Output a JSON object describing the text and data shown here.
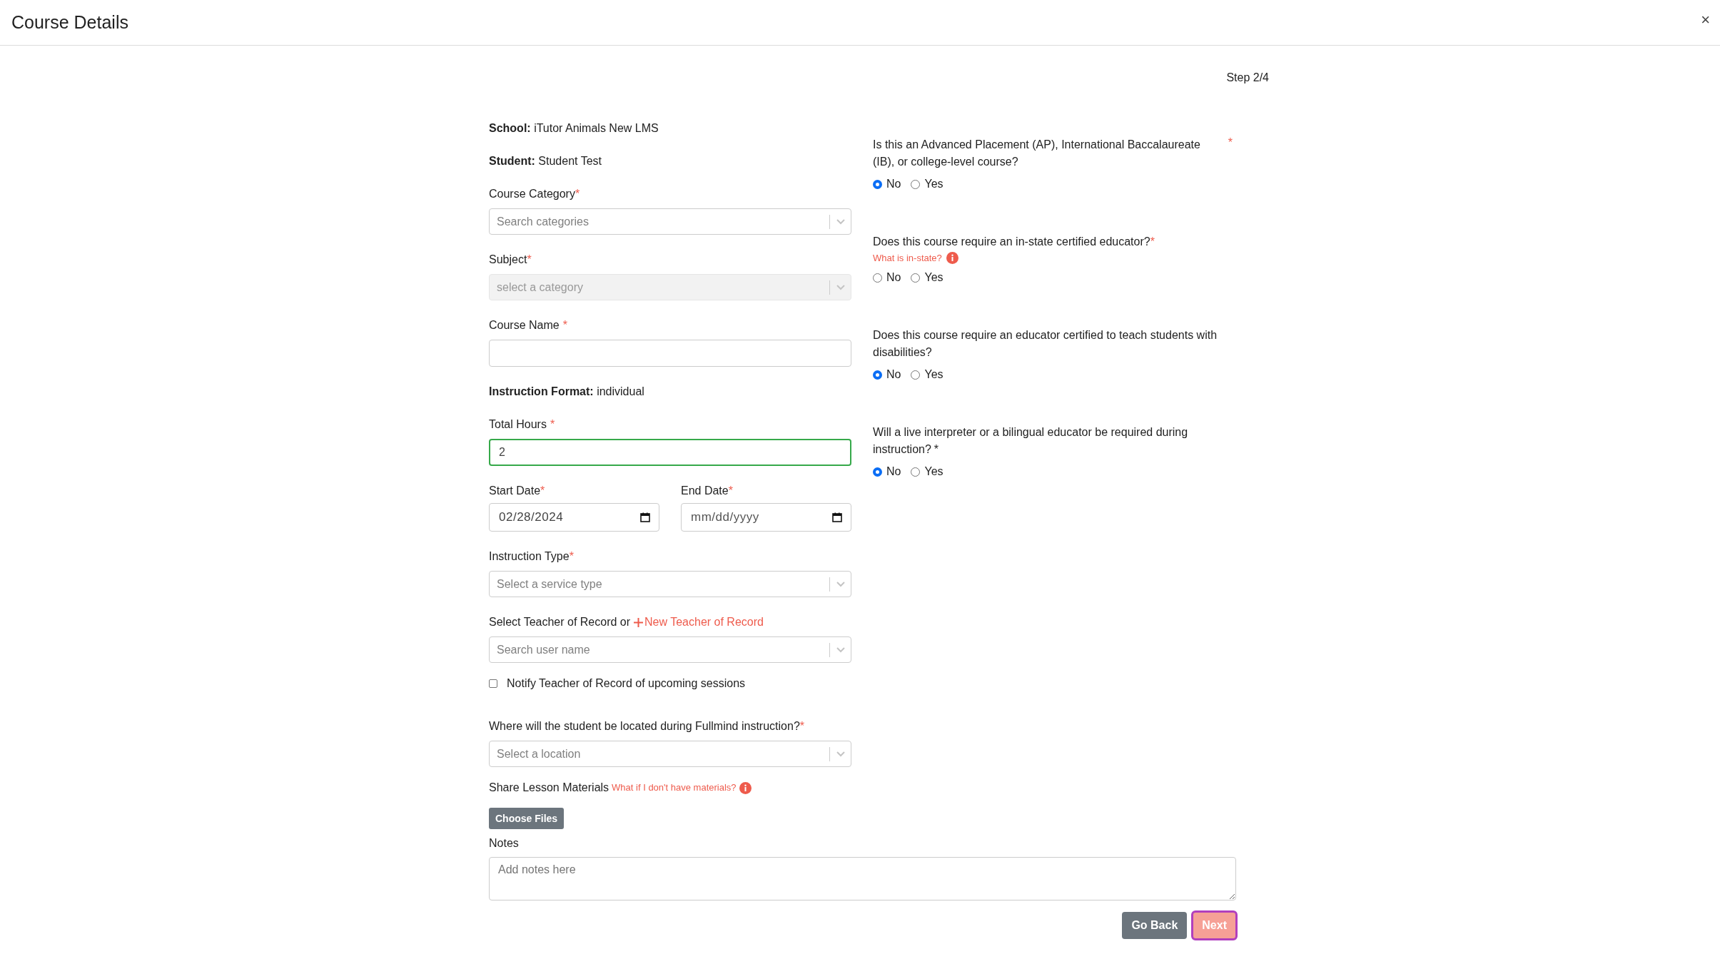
{
  "window": {
    "title": "Course Details",
    "close": "×"
  },
  "step": "Step 2/4",
  "left": [
    {
      "kind": "info",
      "label": "School:",
      "value": "iTutor Animals New LMS"
    },
    {
      "kind": "info",
      "label": "Student:",
      "value": "Student Test"
    },
    {
      "kind": "select",
      "label": "Course Category",
      "asterisk": "*",
      "spaced": false,
      "placeholder": "Search categories",
      "disabled": false
    },
    {
      "kind": "select",
      "label": "Subject",
      "asterisk": "*",
      "spaced": false,
      "placeholder": "select a category",
      "disabled": true
    },
    {
      "kind": "text",
      "label": "Course Name",
      "asterisk": "*",
      "spaced": true,
      "valid": false
    },
    {
      "kind": "info",
      "label": "Instruction Format:",
      "value": "individual"
    },
    {
      "kind": "text",
      "label": "Total Hours",
      "asterisk": "*",
      "spaced": true,
      "value": "2",
      "valid": true
    },
    {
      "kind": "dates",
      "fields": [
        {
          "label": "Start Date",
          "asterisk": "*",
          "value": "02/28/2024"
        },
        {
          "label": "End Date",
          "asterisk": "*",
          "placeholder": "mm/dd/yyyy"
        }
      ]
    },
    {
      "kind": "select",
      "label": "Instruction Type",
      "asterisk": "*",
      "spaced": false,
      "placeholder": "Select a service type",
      "disabled": false
    },
    {
      "kind": "teacher",
      "label": "Select Teacher of Record or",
      "link": "New Teacher of Record"
    },
    {
      "kind": "select",
      "placeholder": "Search user name",
      "disabled": false
    },
    {
      "kind": "checkbox",
      "label": "Notify Teacher of Record of upcoming sessions",
      "checked": false
    },
    {
      "kind": "select",
      "label": "Where will the student be located during Fullmind instruction?",
      "asterisk": "*",
      "spaced": false,
      "placeholder": "Select a location",
      "disabled": false
    },
    {
      "kind": "file",
      "label": "Share Lesson Materials",
      "link": "What if I don't have materials?",
      "button": "Choose Files"
    }
  ],
  "questions": [
    {
      "text": "Is this an Advanced Placement (AP), International Baccalaureate (IB), or college-level course?",
      "asterisk": "*",
      "kind": "far",
      "options": [
        {
          "label": "No",
          "selected": true
        },
        {
          "label": "Yes",
          "selected": false
        }
      ]
    },
    {
      "text": "Does this course require an in-state certified educator?",
      "asterisk": "*",
      "kind": "inline",
      "link": "What is in-state?",
      "options": [
        {
          "label": "No",
          "selected": false
        },
        {
          "label": "Yes",
          "selected": false
        }
      ]
    },
    {
      "text": "Does this course require an educator certified to teach students with disabilities?",
      "options": [
        {
          "label": "No",
          "selected": true
        },
        {
          "label": "Yes",
          "selected": false
        }
      ]
    },
    {
      "text": "Will a live interpreter or a bilingual educator be required during instruction?",
      "asterisk": "*",
      "kind": "plain",
      "options": [
        {
          "label": "No",
          "selected": true
        },
        {
          "label": "Yes",
          "selected": false
        }
      ]
    }
  ],
  "notes": {
    "label": "Notes",
    "placeholder": "Add notes here"
  },
  "buttons": [
    {
      "label": "Go Back",
      "kind": "secondary",
      "focused": false
    },
    {
      "label": "Next",
      "kind": "primary",
      "focused": true
    }
  ]
}
